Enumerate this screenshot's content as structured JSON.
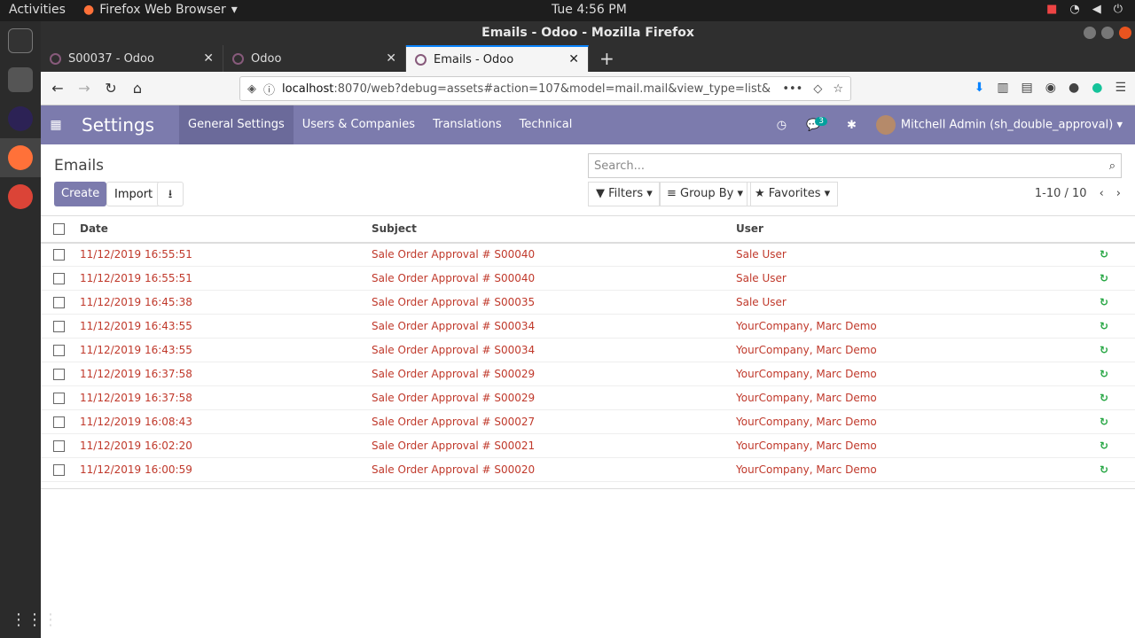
{
  "os": {
    "activities": "Activities",
    "app": "Firefox Web Browser",
    "clock": "Tue  4:56 PM"
  },
  "window": {
    "title": "Emails - Odoo - Mozilla Firefox"
  },
  "tabs": [
    {
      "label": "S00037 - Odoo"
    },
    {
      "label": "Odoo"
    },
    {
      "label": "Emails - Odoo"
    }
  ],
  "url": {
    "host": "localhost",
    "rest": ":8070/web?debug=assets#action=107&model=mail.mail&view_type=list&"
  },
  "odoo": {
    "brand": "Settings",
    "menu": [
      "General Settings",
      "Users & Companies",
      "Translations",
      "Technical"
    ],
    "chat_count": "3",
    "user": "Mitchell Admin (sh_double_approval)"
  },
  "control": {
    "breadcrumb": "Emails",
    "create": "Create",
    "import": "Import",
    "search_placeholder": "Search...",
    "filters": "Filters",
    "groupby": "Group By",
    "favorites": "Favorites",
    "pager": "1-10 / 10"
  },
  "table": {
    "headers": [
      "Date",
      "Subject",
      "User"
    ],
    "rows": [
      [
        "11/12/2019 16:55:51",
        "Sale Order Approval # S00040",
        "Sale User"
      ],
      [
        "11/12/2019 16:55:51",
        "Sale Order Approval # S00040",
        "Sale User"
      ],
      [
        "11/12/2019 16:45:38",
        "Sale Order Approval # S00035",
        "Sale User"
      ],
      [
        "11/12/2019 16:43:55",
        "Sale Order Approval # S00034",
        "YourCompany, Marc Demo"
      ],
      [
        "11/12/2019 16:43:55",
        "Sale Order Approval # S00034",
        "YourCompany, Marc Demo"
      ],
      [
        "11/12/2019 16:37:58",
        "Sale Order Approval # S00029",
        "YourCompany, Marc Demo"
      ],
      [
        "11/12/2019 16:37:58",
        "Sale Order Approval # S00029",
        "YourCompany, Marc Demo"
      ],
      [
        "11/12/2019 16:08:43",
        "Sale Order Approval # S00027",
        "YourCompany, Marc Demo"
      ],
      [
        "11/12/2019 16:02:20",
        "Sale Order Approval # S00021",
        "YourCompany, Marc Demo"
      ],
      [
        "11/12/2019 16:00:59",
        "Sale Order Approval # S00020",
        "YourCompany, Marc Demo"
      ]
    ]
  }
}
